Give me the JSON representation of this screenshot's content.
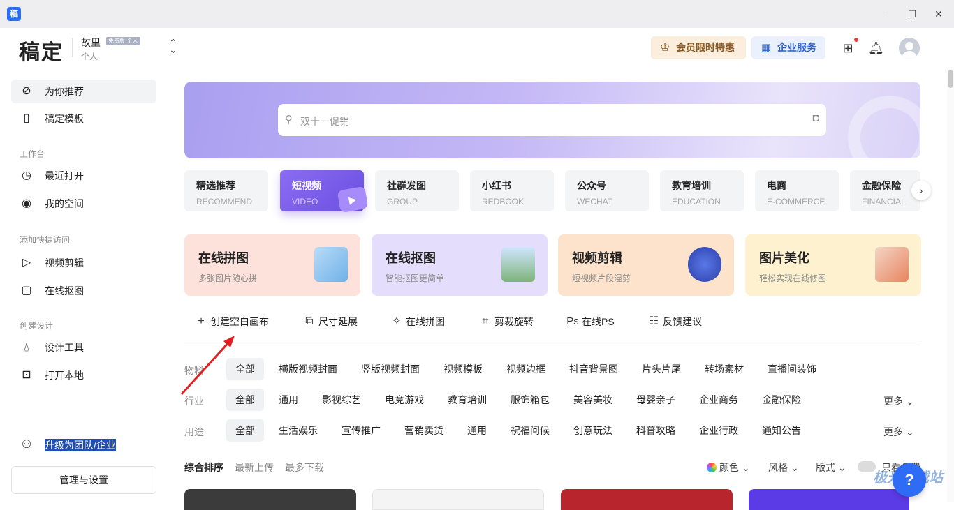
{
  "window": {
    "app_icon": "稿",
    "min": "–",
    "max": "☐",
    "close": "✕"
  },
  "header": {
    "logo": "稿定",
    "workspace_name": "故里",
    "workspace_badge": "免费版·个人",
    "workspace_sub": "个人",
    "vip_label": "会员限时特惠",
    "biz_label": "企业服务"
  },
  "sidebar": {
    "items": [
      {
        "label": "为你推荐",
        "icon": "compass-icon"
      },
      {
        "label": "稿定模板",
        "icon": "template-icon"
      },
      {
        "label": "最近打开",
        "icon": "clock-icon"
      },
      {
        "label": "我的空间",
        "icon": "user-circle-icon"
      },
      {
        "label": "视频剪辑",
        "icon": "play-square-icon"
      },
      {
        "label": "在线抠图",
        "icon": "cutout-icon"
      },
      {
        "label": "设计工具",
        "icon": "pen-tool-icon"
      },
      {
        "label": "打开本地",
        "icon": "folder-plus-icon"
      }
    ],
    "groups": {
      "workbench": "工作台",
      "quick_access": "添加快捷访问",
      "create": "创建设计"
    },
    "upgrade": "升级为团队/企业",
    "manage": "管理与设置"
  },
  "search": {
    "placeholder": "双十一促销"
  },
  "categories": [
    {
      "title": "精选推荐",
      "en": "RECOMMEND"
    },
    {
      "title": "短视频",
      "en": "VIDEO"
    },
    {
      "title": "社群发图",
      "en": "GROUP"
    },
    {
      "title": "小红书",
      "en": "REDBOOK"
    },
    {
      "title": "公众号",
      "en": "WECHAT"
    },
    {
      "title": "教育培训",
      "en": "EDUCATION"
    },
    {
      "title": "电商",
      "en": "E-COMMERCE"
    },
    {
      "title": "金融保险",
      "en": "FINANCIAL"
    }
  ],
  "tools": [
    {
      "title": "在线拼图",
      "sub": "多张图片随心拼",
      "bg": "#fde2dc"
    },
    {
      "title": "在线抠图",
      "sub": "智能抠图更简单",
      "bg": "#e4defc"
    },
    {
      "title": "视频剪辑",
      "sub": "短视频片段混剪",
      "bg": "#fde3cc"
    },
    {
      "title": "图片美化",
      "sub": "轻松实现在线修图",
      "bg": "#fdf1cf"
    }
  ],
  "quick_actions": [
    {
      "label": "创建空白画布",
      "icon": "plus-icon",
      "glyph": "+"
    },
    {
      "label": "尺寸延展",
      "icon": "resize-icon",
      "glyph": "⧉"
    },
    {
      "label": "在线拼图",
      "icon": "puzzle-icon",
      "glyph": "✧"
    },
    {
      "label": "剪裁旋转",
      "icon": "crop-icon",
      "glyph": "⌗"
    },
    {
      "label": "在线PS",
      "icon": "ps-icon",
      "glyph": "Ps"
    },
    {
      "label": "反馈建议",
      "icon": "feedback-icon",
      "glyph": "☷"
    }
  ],
  "filters": {
    "material": {
      "label": "物料",
      "chips": [
        "全部",
        "横版视频封面",
        "竖版视频封面",
        "视频模板",
        "视频边框",
        "抖音背景图",
        "片头片尾",
        "转场素材",
        "直播间装饰"
      ]
    },
    "industry": {
      "label": "行业",
      "chips": [
        "全部",
        "通用",
        "影视综艺",
        "电竞游戏",
        "教育培训",
        "服饰箱包",
        "美容美妆",
        "母婴亲子",
        "企业商务",
        "金融保险"
      ],
      "more": "更多 ⌄"
    },
    "usage": {
      "label": "用途",
      "chips": [
        "全部",
        "生活娱乐",
        "宣传推广",
        "营销卖货",
        "通用",
        "祝福问候",
        "创意玩法",
        "科普攻略",
        "企业行政",
        "通知公告"
      ],
      "more": "更多 ⌄"
    }
  },
  "sort": {
    "options": [
      "综合排序",
      "最新上传",
      "最多下载"
    ],
    "color": "颜色 ⌄",
    "style": "风格 ⌄",
    "format": "版式 ⌄",
    "only_free": "只看免费"
  },
  "help": "?",
  "watermark": "极光下载站"
}
